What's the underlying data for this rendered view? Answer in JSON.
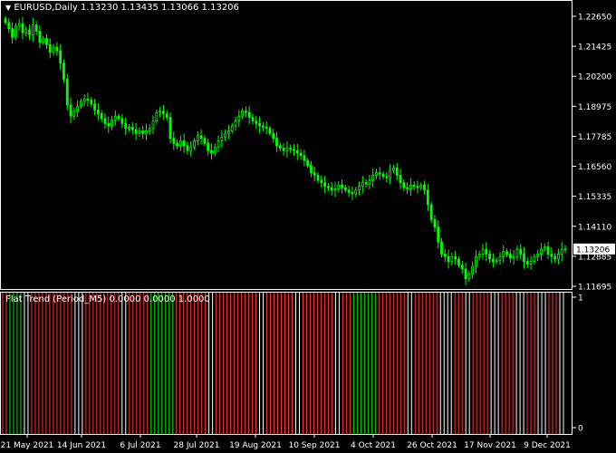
{
  "chart": {
    "symbol_line": "EURUSD,Daily  1.13230 1.13435 1.13066 1.13206",
    "indicator_line": "Flat Trend (Period_M5) 0.0000 0.0000 1.0000",
    "current_price": "1.13206",
    "price_ticks": [
      "1.22650",
      "1.21425",
      "1.20200",
      "1.18975",
      "1.17785",
      "1.16560",
      "1.15335",
      "1.14110",
      "1.12885",
      "1.11695"
    ],
    "ind_ticks": [
      "1",
      "0"
    ],
    "date_ticks": [
      "21 May 2021",
      "14 Jun 2021",
      "6 Jul 2021",
      "28 Jul 2021",
      "19 Aug 2021",
      "10 Sep 2021",
      "4 Oct 2021",
      "26 Oct 2021",
      "17 Nov 2021",
      "9 Dec 2021"
    ],
    "colors": {
      "background": "#000000",
      "candles": "#00ff00",
      "axis": "#ffffff",
      "bar_down": "#ff3030",
      "bar_up": "#00e000",
      "bar_flat": "#ffffff"
    }
  },
  "chart_data": [
    {
      "type": "candlestick",
      "title": "EURUSD,Daily",
      "x_range": [
        "21 May 2021",
        "16 Dec 2021"
      ],
      "ylim": [
        1.116,
        1.232
      ],
      "close": [
        1.224,
        1.2215,
        1.218,
        1.2225,
        1.2235,
        1.2198,
        1.221,
        1.219,
        1.223,
        1.2205,
        1.216,
        1.2175,
        1.215,
        1.212,
        1.214,
        1.2125,
        1.2075,
        1.201,
        1.1905,
        1.186,
        1.188,
        1.19,
        1.192,
        1.193,
        1.1925,
        1.191,
        1.1885,
        1.187,
        1.185,
        1.183,
        1.182,
        1.1845,
        1.186,
        1.185,
        1.183,
        1.181,
        1.1815,
        1.1805,
        1.179,
        1.18,
        1.179,
        1.18,
        1.181,
        1.184,
        1.1875,
        1.188,
        1.187,
        1.1855,
        1.177,
        1.175,
        1.174,
        1.176,
        1.174,
        1.172,
        1.1735,
        1.176,
        1.178,
        1.177,
        1.175,
        1.172,
        1.171,
        1.1735,
        1.176,
        1.1775,
        1.179,
        1.18,
        1.182,
        1.184,
        1.186,
        1.188,
        1.1875,
        1.1855,
        1.184,
        1.183,
        1.182,
        1.1815,
        1.181,
        1.179,
        1.177,
        1.174,
        1.173,
        1.172,
        1.173,
        1.1725,
        1.172,
        1.171,
        1.17,
        1.168,
        1.166,
        1.163,
        1.162,
        1.16,
        1.159,
        1.1575,
        1.157,
        1.156,
        1.1565,
        1.158,
        1.157,
        1.156,
        1.155,
        1.1545,
        1.156,
        1.1575,
        1.159,
        1.1585,
        1.16,
        1.162,
        1.163,
        1.1625,
        1.1615,
        1.161,
        1.164,
        1.165,
        1.162,
        1.159,
        1.157,
        1.1565,
        1.158,
        1.1575,
        1.157,
        1.158,
        1.156,
        1.15,
        1.144,
        1.141,
        1.135,
        1.13,
        1.129,
        1.127,
        1.129,
        1.128,
        1.1255,
        1.124,
        1.12,
        1.122,
        1.125,
        1.129,
        1.13,
        1.132,
        1.13,
        1.128,
        1.127,
        1.1275,
        1.129,
        1.131,
        1.13,
        1.1285,
        1.129,
        1.132,
        1.13,
        1.127,
        1.126,
        1.127,
        1.129,
        1.13,
        1.132,
        1.133,
        1.13,
        1.129,
        1.128,
        1.13,
        1.132,
        1.1321
      ]
    },
    {
      "type": "bar",
      "title": "Flat Trend (Period_M5)",
      "ylim": [
        0,
        1
      ],
      "segments": [
        {
          "state": "down",
          "count": 2
        },
        {
          "state": "up",
          "count": 4
        },
        {
          "state": "flat",
          "count": 2
        },
        {
          "state": "down",
          "count": 12
        },
        {
          "state": "flat",
          "count": 3
        },
        {
          "state": "down",
          "count": 10
        },
        {
          "state": "flat",
          "count": 2
        },
        {
          "state": "down",
          "count": 6
        },
        {
          "state": "up",
          "count": 7
        },
        {
          "state": "down",
          "count": 9
        },
        {
          "state": "flat",
          "count": 2
        },
        {
          "state": "down",
          "count": 12
        },
        {
          "state": "flat",
          "count": 2
        },
        {
          "state": "down",
          "count": 8
        },
        {
          "state": "flat",
          "count": 2
        },
        {
          "state": "down",
          "count": 9
        },
        {
          "state": "flat",
          "count": 2
        },
        {
          "state": "down",
          "count": 3
        },
        {
          "state": "up",
          "count": 7
        },
        {
          "state": "down",
          "count": 8
        },
        {
          "state": "flat",
          "count": 2
        },
        {
          "state": "down",
          "count": 7
        },
        {
          "state": "flat",
          "count": 4
        },
        {
          "state": "down",
          "count": 3
        },
        {
          "state": "flat",
          "count": 2
        },
        {
          "state": "down",
          "count": 5
        },
        {
          "state": "flat",
          "count": 3
        },
        {
          "state": "down",
          "count": 4
        },
        {
          "state": "flat",
          "count": 3
        },
        {
          "state": "down",
          "count": 3
        },
        {
          "state": "flat",
          "count": 3
        },
        {
          "state": "down",
          "count": 3
        },
        {
          "state": "flat",
          "count": 2
        }
      ]
    }
  ]
}
